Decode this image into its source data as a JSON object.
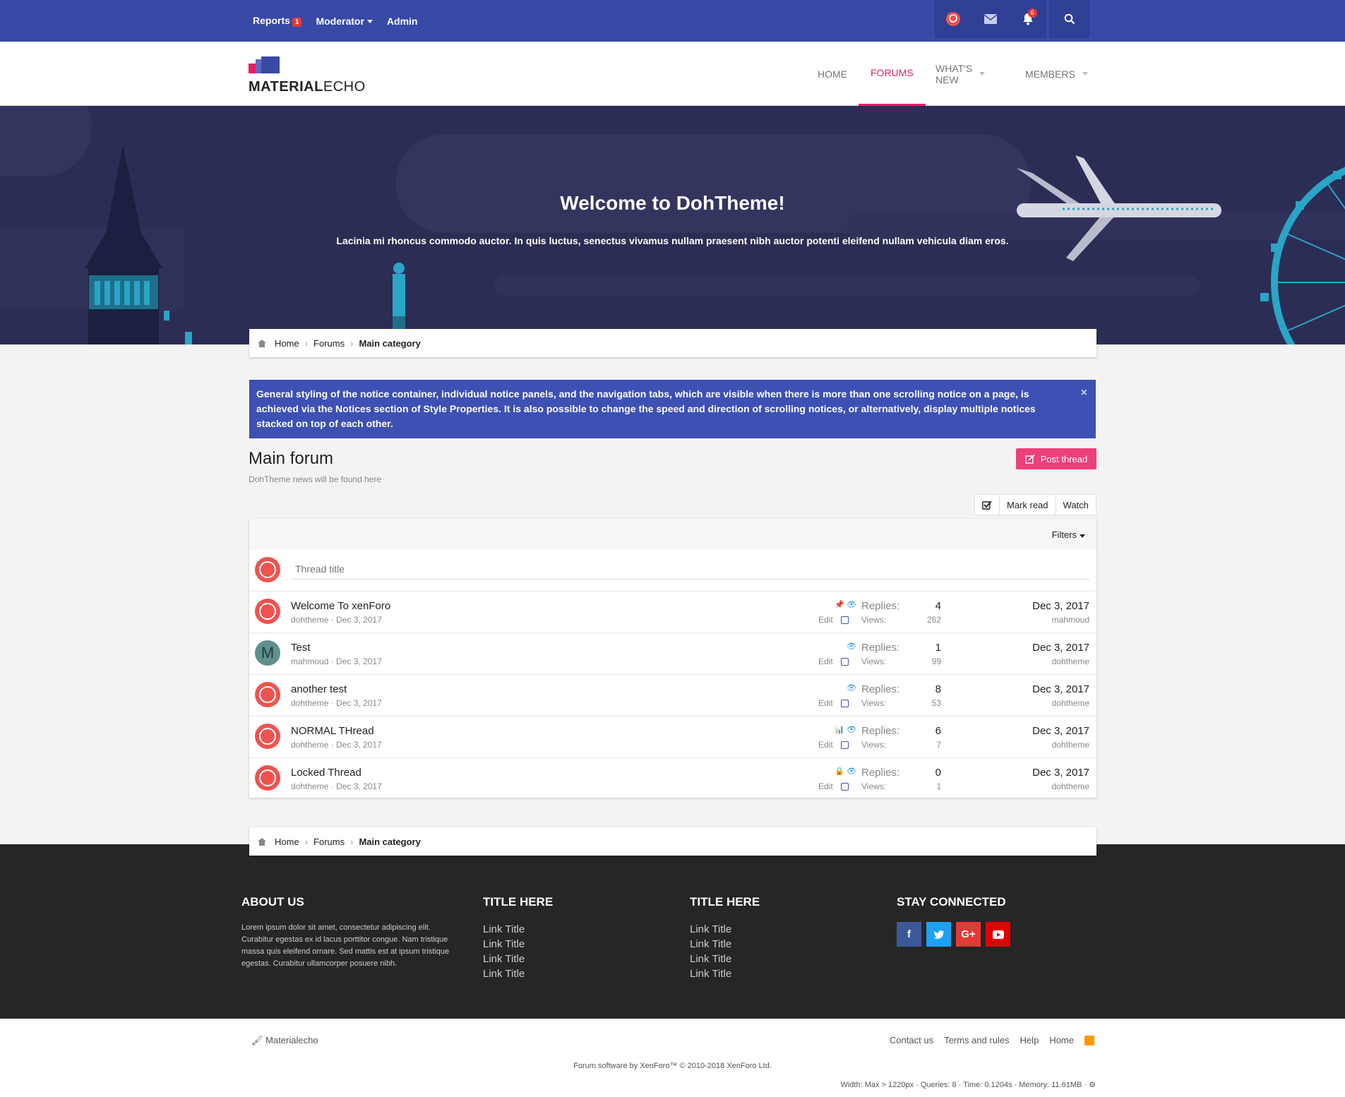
{
  "admin_bar": {
    "reports_label": "Reports",
    "reports_count": "1",
    "moderator_label": "Moderator",
    "admin_label": "Admin",
    "alerts_count": "6"
  },
  "site": {
    "logo_bold": "MATERIAL",
    "logo_light": "ECHO"
  },
  "nav": {
    "home": "HOME",
    "forums": "FORUMS",
    "whats_new": "WHAT'S NEW",
    "members": "MEMBERS"
  },
  "banner": {
    "title": "Welcome to DohTheme!",
    "text": "Lacinia mi rhoncus commodo auctor. In quis luctus, senectus vivamus nullam praesent nibh auctor potenti eleifend nullam vehicula diam eros."
  },
  "breadcrumb": {
    "home": "Home",
    "forums": "Forums",
    "current": "Main category"
  },
  "notice": {
    "text": "General styling of the notice container, individual notice panels, and the navigation tabs, which are visible when there is more than one scrolling notice on a page, is achieved via the Notices section of Style Properties. It is also possible to change the speed and direction of scrolling notices, or alternatively, display multiple notices stacked on top of each other.",
    "close": "×"
  },
  "forum": {
    "title": "Main forum",
    "description": "DohTheme news will be found here",
    "post_thread": "Post thread",
    "mark_read": "Mark read",
    "watch": "Watch",
    "filters": "Filters",
    "thread_title_placeholder": "Thread title"
  },
  "threads": [
    {
      "title": "Welcome To xenForo",
      "author": "dohtheme",
      "date": "Dec 3, 2017",
      "replies_label": "Replies:",
      "replies": "4",
      "views_label": "Views:",
      "views": "262",
      "last_date": "Dec 3, 2017",
      "last_user": "mahmoud",
      "edit": "Edit",
      "status_icons": "📌"
    },
    {
      "title": "Test",
      "author": "mahmoud",
      "date": "Dec 3, 2017",
      "replies_label": "Replies:",
      "replies": "1",
      "views_label": "Views:",
      "views": "99",
      "last_date": "Dec 3, 2017",
      "last_user": "dohtheme",
      "edit": "Edit",
      "status_icons": ""
    },
    {
      "title": "another test",
      "author": "dohtheme",
      "date": "Dec 3, 2017",
      "replies_label": "Replies:",
      "replies": "8",
      "views_label": "Views:",
      "views": "53",
      "last_date": "Dec 3, 2017",
      "last_user": "dohtheme",
      "edit": "Edit",
      "status_icons": ""
    },
    {
      "title": "NORMAL THread",
      "author": "dohtheme",
      "date": "Dec 3, 2017",
      "replies_label": "Replies:",
      "replies": "6",
      "views_label": "Views:",
      "views": "7",
      "last_date": "Dec 3, 2017",
      "last_user": "dohtheme",
      "edit": "Edit",
      "status_icons": "📊"
    },
    {
      "title": "Locked Thread",
      "author": "dohtheme",
      "date": "Dec 3, 2017",
      "replies_label": "Replies:",
      "replies": "0",
      "views_label": "Views:",
      "views": "1",
      "last_date": "Dec 3, 2017",
      "last_user": "dohtheme",
      "edit": "Edit",
      "status_icons": "🔒"
    }
  ],
  "footer": {
    "about_title": "ABOUT US",
    "about_text": "Lorem ipsum dolor sit amet, consectetur adipiscing elit. Curabitur egestas ex id lacus porttitor congue. Nam tristique massa quis eleifend ornare. Sed mattis est at ipsum tristique egestas. Curabitur ullamcorper posuere nibh.",
    "col2_title": "TITLE HERE",
    "col3_title": "TITLE HERE",
    "link": "Link Title",
    "social_title": "STAY CONNECTED",
    "facebook": "f",
    "google": "G+"
  },
  "bottom": {
    "style_name": "Materialecho",
    "contact": "Contact us",
    "terms": "Terms and rules",
    "help": "Help",
    "home": "Home",
    "copyright": "Forum software by XenForo™ © 2010-2018 XenForo Ltd.",
    "debug": "Width: Max > 1220px · Queries: 8 · Time: 0.1204s · Memory: 11.61MB ·"
  },
  "colors": {
    "admin_bar": "#3849a6",
    "accent": "#e91e63",
    "notice": "#3d50b4",
    "banner": "#2b2d55",
    "footer": "#262626"
  }
}
